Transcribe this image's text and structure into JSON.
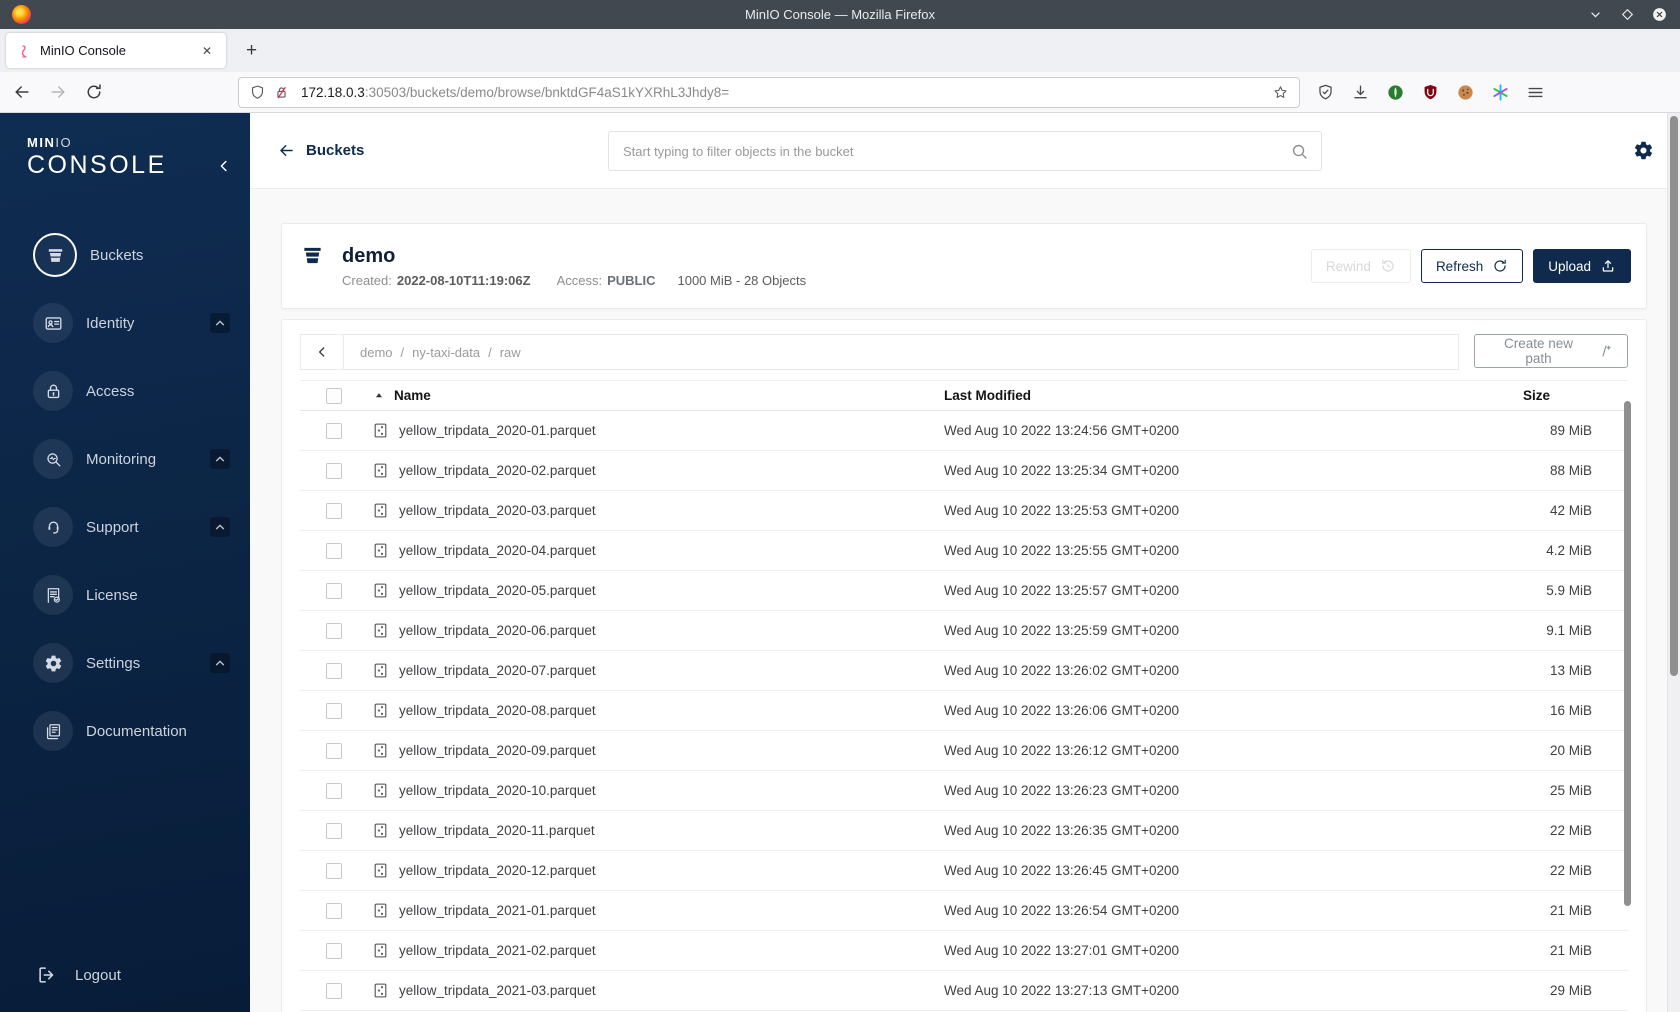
{
  "colors": {
    "accent": "#0f2a4d",
    "sidebar_top": "#0f2c52",
    "sidebar_bottom": "#081c38",
    "titlebar": "#42484f",
    "disabled_text": "#d8d8d8"
  },
  "browser": {
    "window_title": "MinIO Console — Mozilla Firefox",
    "tab_title": "MinIO Console",
    "tab_close_glyph": "✕",
    "new_tab_glyph": "+",
    "url_host": "172.18.0.3",
    "url_rest": ":30503/buckets/demo/browse/bnktdGF4aS1kYXRhL3Jhdy8="
  },
  "sidebar": {
    "logo_min": "MIN",
    "logo_io": "IO",
    "logo_console": "CONSOLE",
    "items": [
      {
        "label": "Buckets",
        "icon": "bucket",
        "active": true,
        "expandable": false
      },
      {
        "label": "Identity",
        "icon": "identity-card",
        "active": false,
        "expandable": true
      },
      {
        "label": "Access",
        "icon": "lock",
        "active": false,
        "expandable": false
      },
      {
        "label": "Monitoring",
        "icon": "monitoring",
        "active": false,
        "expandable": true
      },
      {
        "label": "Support",
        "icon": "support",
        "active": false,
        "expandable": true
      },
      {
        "label": "License",
        "icon": "license",
        "active": false,
        "expandable": false
      },
      {
        "label": "Settings",
        "icon": "gear",
        "active": false,
        "expandable": true
      },
      {
        "label": "Documentation",
        "icon": "documentation",
        "active": false,
        "expandable": false
      }
    ],
    "logout_label": "Logout"
  },
  "topbar": {
    "back_label": "Buckets",
    "search_placeholder": "Start typing to filter objects in the bucket"
  },
  "bucket": {
    "name": "demo",
    "created_label": "Created:",
    "created_value": "2022-08-10T11:19:06Z",
    "access_label": "Access:",
    "access_value": "PUBLIC",
    "stats": "1000 MiB - 28 Objects",
    "rewind_label": "Rewind",
    "refresh_label": "Refresh",
    "upload_label": "Upload"
  },
  "browse": {
    "breadcrumb": [
      "demo",
      "ny-taxi-data",
      "raw"
    ],
    "separator": "/",
    "create_path_label": "Create new path"
  },
  "objects_table": {
    "headers": {
      "name": "Name",
      "modified": "Last Modified",
      "size": "Size"
    },
    "rows": [
      {
        "name": "yellow_tripdata_2020-01.parquet",
        "modified": "Wed Aug 10 2022 13:24:56 GMT+0200",
        "size": "89 MiB"
      },
      {
        "name": "yellow_tripdata_2020-02.parquet",
        "modified": "Wed Aug 10 2022 13:25:34 GMT+0200",
        "size": "88 MiB"
      },
      {
        "name": "yellow_tripdata_2020-03.parquet",
        "modified": "Wed Aug 10 2022 13:25:53 GMT+0200",
        "size": "42 MiB"
      },
      {
        "name": "yellow_tripdata_2020-04.parquet",
        "modified": "Wed Aug 10 2022 13:25:55 GMT+0200",
        "size": "4.2 MiB"
      },
      {
        "name": "yellow_tripdata_2020-05.parquet",
        "modified": "Wed Aug 10 2022 13:25:57 GMT+0200",
        "size": "5.9 MiB"
      },
      {
        "name": "yellow_tripdata_2020-06.parquet",
        "modified": "Wed Aug 10 2022 13:25:59 GMT+0200",
        "size": "9.1 MiB"
      },
      {
        "name": "yellow_tripdata_2020-07.parquet",
        "modified": "Wed Aug 10 2022 13:26:02 GMT+0200",
        "size": "13 MiB"
      },
      {
        "name": "yellow_tripdata_2020-08.parquet",
        "modified": "Wed Aug 10 2022 13:26:06 GMT+0200",
        "size": "16 MiB"
      },
      {
        "name": "yellow_tripdata_2020-09.parquet",
        "modified": "Wed Aug 10 2022 13:26:12 GMT+0200",
        "size": "20 MiB"
      },
      {
        "name": "yellow_tripdata_2020-10.parquet",
        "modified": "Wed Aug 10 2022 13:26:23 GMT+0200",
        "size": "25 MiB"
      },
      {
        "name": "yellow_tripdata_2020-11.parquet",
        "modified": "Wed Aug 10 2022 13:26:35 GMT+0200",
        "size": "22 MiB"
      },
      {
        "name": "yellow_tripdata_2020-12.parquet",
        "modified": "Wed Aug 10 2022 13:26:45 GMT+0200",
        "size": "22 MiB"
      },
      {
        "name": "yellow_tripdata_2021-01.parquet",
        "modified": "Wed Aug 10 2022 13:26:54 GMT+0200",
        "size": "21 MiB"
      },
      {
        "name": "yellow_tripdata_2021-02.parquet",
        "modified": "Wed Aug 10 2022 13:27:01 GMT+0200",
        "size": "21 MiB"
      },
      {
        "name": "yellow_tripdata_2021-03.parquet",
        "modified": "Wed Aug 10 2022 13:27:13 GMT+0200",
        "size": "29 MiB"
      }
    ]
  }
}
